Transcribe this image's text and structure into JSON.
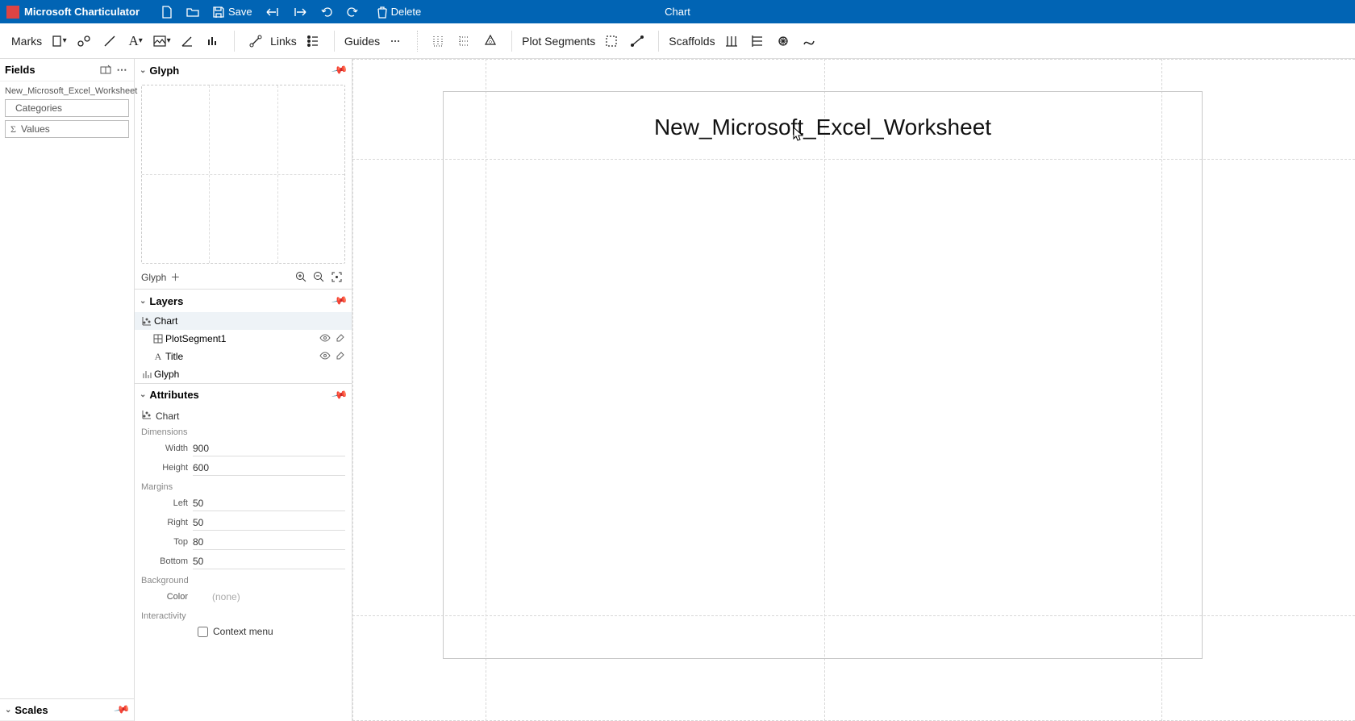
{
  "titlebar": {
    "app_name": "Microsoft Charticulator",
    "save_label": "Save",
    "delete_label": "Delete",
    "center_title": "Chart"
  },
  "toolbar": {
    "marks_label": "Marks",
    "links_label": "Links",
    "guides_label": "Guides",
    "plot_segments_label": "Plot Segments",
    "scaffolds_label": "Scaffolds"
  },
  "fields": {
    "panel_title": "Fields",
    "dataset_name": "New_Microsoft_Excel_Worksheet",
    "items": [
      {
        "icon": "",
        "label": "Categories"
      },
      {
        "icon": "Σ",
        "label": "Values"
      }
    ]
  },
  "scales": {
    "panel_title": "Scales"
  },
  "glyph": {
    "panel_title": "Glyph",
    "footer_label": "Glyph"
  },
  "layers": {
    "panel_title": "Layers",
    "items": [
      {
        "name": "Chart",
        "level": 0,
        "icon": "chart",
        "selected": true,
        "eye": false,
        "erase": false
      },
      {
        "name": "PlotSegment1",
        "level": 1,
        "icon": "grid",
        "selected": false,
        "eye": true,
        "erase": true
      },
      {
        "name": "Title",
        "level": 1,
        "icon": "text",
        "selected": false,
        "eye": true,
        "erase": true
      },
      {
        "name": "Glyph",
        "level": 0,
        "icon": "glyph",
        "selected": false,
        "eye": false,
        "erase": false
      }
    ]
  },
  "attributes": {
    "panel_title": "Attributes",
    "target": "Chart",
    "sections": {
      "dimensions_label": "Dimensions",
      "margins_label": "Margins",
      "background_label": "Background",
      "interactivity_label": "Interactivity"
    },
    "dimensions": {
      "width_label": "Width",
      "width": "900",
      "height_label": "Height",
      "height": "600"
    },
    "margins": {
      "left_label": "Left",
      "left": "50",
      "right_label": "Right",
      "right": "50",
      "top_label": "Top",
      "top": "80",
      "bottom_label": "Bottom",
      "bottom": "50"
    },
    "background": {
      "color_label": "Color",
      "color_value": "(none)"
    },
    "interactivity": {
      "context_menu_label": "Context menu",
      "context_menu_checked": false
    }
  },
  "canvas": {
    "chart_title": "New_Microsoft_Excel_Worksheet"
  }
}
